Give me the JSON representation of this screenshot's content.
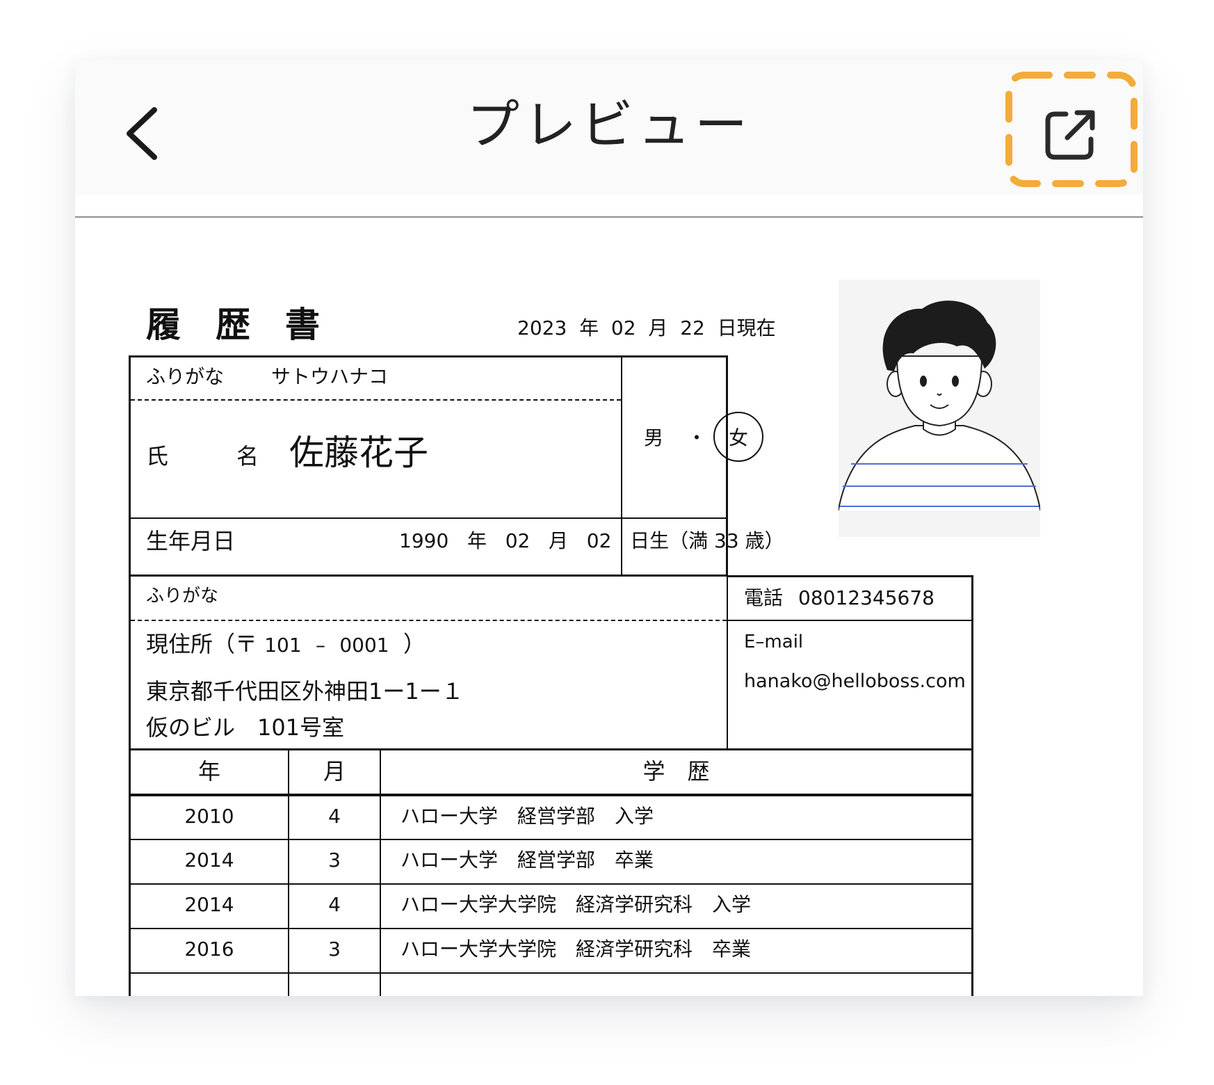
{
  "header": {
    "title": "プレビュー",
    "back_icon": "chevron-left-icon",
    "share_icon": "external-link-icon",
    "highlight_color": "#F2AC3A"
  },
  "resume": {
    "title": "履　歴　書",
    "date": {
      "year": "2023",
      "year_unit": "年",
      "month": "02",
      "month_unit": "月",
      "day": "22",
      "day_unit": "日現在"
    },
    "furigana_label": "ふりがな",
    "furigana_value": "サトウハナコ",
    "name_label_1": "氏",
    "name_label_2": "名",
    "name_value": "佐藤花子",
    "gender_male": "男",
    "gender_dot": "・",
    "gender_female": "女",
    "birth_label": "生年月日",
    "birth_year": "1990",
    "birth_year_unit": "年",
    "birth_month": "02",
    "birth_month_unit": "月",
    "birth_day": "02",
    "birth_day_unit": "日生（満",
    "birth_age": "33",
    "birth_age_unit": "歳）",
    "addr_furigana_label": "ふりがな",
    "addr_label": "現住所（〒",
    "postal_1": "101",
    "postal_dash": "–",
    "postal_2": "0001",
    "postal_close": "）",
    "address_line1": "東京都千代田区外神田1ー1ー１",
    "address_line2": "仮のビル　101号室",
    "phone_label": "電話",
    "phone_value": "08012345678",
    "email_label": "E–mail",
    "email_value": "hanako@helloboss.com",
    "table_headers": {
      "year": "年",
      "month": "月",
      "history": "学　歴"
    },
    "education": [
      {
        "year": "2010",
        "month": "4",
        "text": "ハロー大学　経営学部　入学"
      },
      {
        "year": "2014",
        "month": "3",
        "text": "ハロー大学　経営学部　卒業"
      },
      {
        "year": "2014",
        "month": "4",
        "text": "ハロー大学大学院　経済学研究科　入学"
      },
      {
        "year": "2016",
        "month": "3",
        "text": "ハロー大学大学院　経済学研究科　卒業"
      }
    ]
  }
}
